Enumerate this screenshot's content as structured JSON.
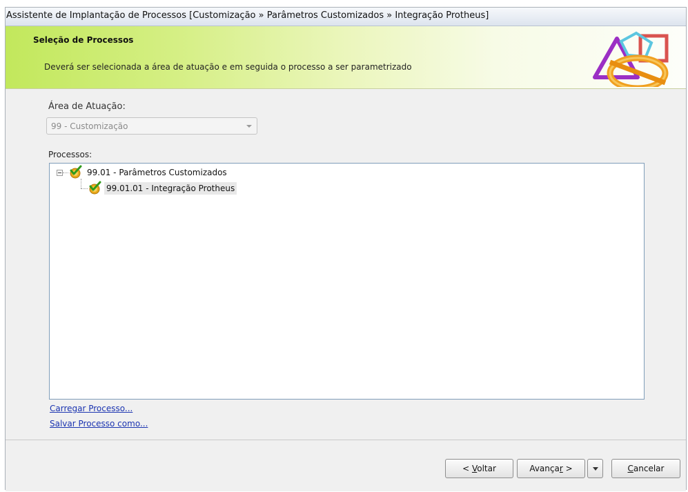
{
  "window": {
    "title": "Assistente de Implantação de Processos [Customização » Parâmetros Customizados » Integração Protheus]"
  },
  "banner": {
    "title": "Seleção de Processos",
    "subtitle": "Deverá ser selecionada a área de atuação e em seguida o processo a ser parametrizado",
    "logo_icon": "geometric-shapes-logo"
  },
  "area": {
    "label": "Área de Atuação:",
    "selected": "99 - Customização"
  },
  "processes": {
    "label": "Processos:",
    "tree": [
      {
        "label": "99.01 - Parâmetros Customizados",
        "icon": "checked-process-icon",
        "expanded": true
      },
      {
        "label": "99.01.01 - Integração Protheus",
        "icon": "checked-process-icon",
        "selected": true
      }
    ]
  },
  "links": {
    "load": "Carregar Processo...",
    "save_as": "Salvar Processo como..."
  },
  "buttons": {
    "back_prefix": "< ",
    "back_key": "V",
    "back_rest": "oltar",
    "next_prefix": "Avança",
    "next_key": "r",
    "next_rest": " >",
    "cancel_key": "C",
    "cancel_rest": "ancelar"
  },
  "colors": {
    "banner_start": "#c2e85c",
    "link": "#1a33b0",
    "tree_border": "#7f9db9"
  }
}
